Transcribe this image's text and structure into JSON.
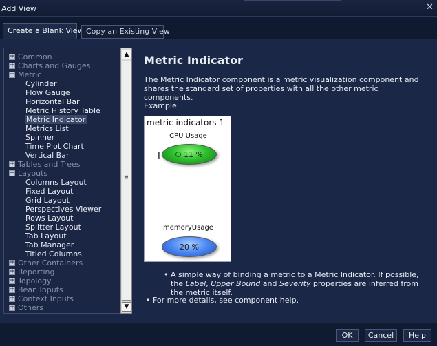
{
  "window": {
    "title": "Add View",
    "close_glyph": "✕"
  },
  "tabs": [
    {
      "label": "Create a Blank View",
      "active": true
    },
    {
      "label": "Copy an Existing View",
      "active": false
    }
  ],
  "tree": {
    "rows": [
      {
        "label": "Common",
        "kind": "cat",
        "expander": "+"
      },
      {
        "label": "Charts and Gauges",
        "kind": "cat",
        "expander": "+"
      },
      {
        "label": "Metric",
        "kind": "cat",
        "expander": "−"
      },
      {
        "label": "Cylinder",
        "kind": "leaf"
      },
      {
        "label": "Flow Gauge",
        "kind": "leaf"
      },
      {
        "label": "Horizontal Bar",
        "kind": "leaf"
      },
      {
        "label": "Metric History Table",
        "kind": "leaf"
      },
      {
        "label": "Metric Indicator",
        "kind": "leaf",
        "selected": true
      },
      {
        "label": "Metrics List",
        "kind": "leaf"
      },
      {
        "label": "Spinner",
        "kind": "leaf"
      },
      {
        "label": "Time Plot Chart",
        "kind": "leaf"
      },
      {
        "label": "Vertical Bar",
        "kind": "leaf"
      },
      {
        "label": "Tables and Trees",
        "kind": "cat",
        "expander": "+"
      },
      {
        "label": "Layouts",
        "kind": "cat",
        "expander": "−"
      },
      {
        "label": "Columns Layout",
        "kind": "leaf"
      },
      {
        "label": "Fixed Layout",
        "kind": "leaf"
      },
      {
        "label": "Grid Layout",
        "kind": "leaf"
      },
      {
        "label": "Perspectives Viewer",
        "kind": "leaf"
      },
      {
        "label": "Rows Layout",
        "kind": "leaf"
      },
      {
        "label": "Splitter Layout",
        "kind": "leaf"
      },
      {
        "label": "Tab Layout",
        "kind": "leaf"
      },
      {
        "label": "Tab Manager",
        "kind": "leaf"
      },
      {
        "label": "Titled Columns",
        "kind": "leaf"
      },
      {
        "label": "Other Containers",
        "kind": "cat",
        "expander": "+"
      },
      {
        "label": "Reporting",
        "kind": "cat",
        "expander": "+"
      },
      {
        "label": "Topology",
        "kind": "cat",
        "expander": "+"
      },
      {
        "label": "Bean Inputs",
        "kind": "cat",
        "expander": "+"
      },
      {
        "label": "Context Inputs",
        "kind": "cat",
        "expander": "+"
      },
      {
        "label": "Others",
        "kind": "cat",
        "expander": "+"
      }
    ]
  },
  "scrollbar": {
    "up_glyph": "▲",
    "down_glyph": "▼",
    "grip_glyph": "≡"
  },
  "detail": {
    "title": "Metric Indicator",
    "description": "The Metric Indicator component is a metric visualization component and shares the standard set of properties with all the other metric components.",
    "example_label": "Example",
    "example": {
      "title": "metric indicators 1",
      "metrics": [
        {
          "label": "CPU Usage",
          "value": "11 %",
          "color": "#2fbf2f"
        },
        {
          "label": "memoryUsage",
          "value": "20 %",
          "color": "#4f8cf5"
        }
      ]
    },
    "bullet1": {
      "pre": "A simple way of binding a metric to a Metric Indicator. If possible, the ",
      "label_em": "Label",
      "mid1": ", ",
      "upper_em": "Upper Bound",
      "mid2": " and ",
      "severity_em": "Severity",
      "post": " properties are inferred from the metric itself."
    },
    "bullet2": "For more details, see component help.",
    "bullet_glyph": "•"
  },
  "footer": {
    "ok": "OK",
    "cancel": "Cancel",
    "help": "Help"
  }
}
